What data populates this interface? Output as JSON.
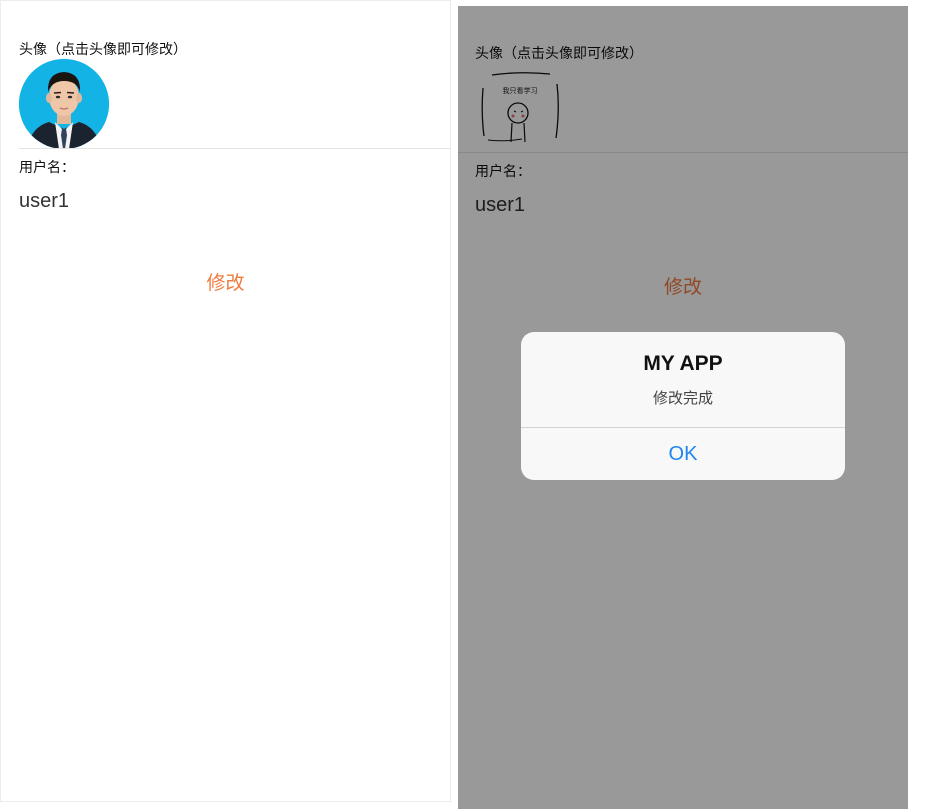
{
  "left_screen": {
    "avatar_label": "头像（点击头像即可修改）",
    "username_label": "用户名：",
    "username_value": "user1",
    "edit_button_label": "修改"
  },
  "right_screen": {
    "avatar_label": "头像（点击头像即可修改）",
    "sketch_caption": "我只看学习",
    "username_label": "用户名：",
    "username_value": "user1",
    "edit_button_label": "修改"
  },
  "dialog": {
    "title": "MY APP",
    "message": "修改完成",
    "ok_label": "OK"
  },
  "colors": {
    "accent_edit": "#f07b3f",
    "dialog_button": "#1f86ef",
    "overlay": "rgba(0,0,0,0.40)",
    "avatar_background": "#13b3e6"
  }
}
